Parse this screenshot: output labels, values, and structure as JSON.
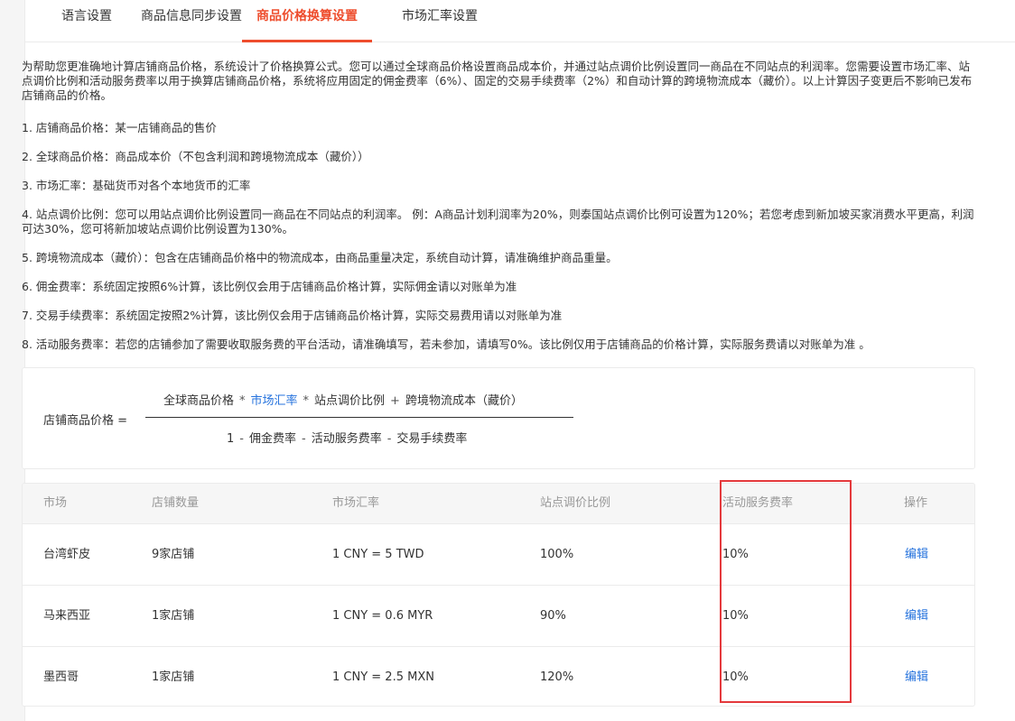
{
  "tabs": [
    {
      "label": "语言设置",
      "active": false
    },
    {
      "label": "商品信息同步设置",
      "active": false
    },
    {
      "label": "商品价格换算设置",
      "active": true
    },
    {
      "label": "市场汇率设置",
      "active": false
    }
  ],
  "intro": "为帮助您更准确地计算店铺商品价格，系统设计了价格换算公式。您可以通过全球商品价格设置商品成本价，并通过站点调价比例设置同一商品在不同站点的利润率。您需要设置市场汇率、站点调价比例和活动服务费率以用于换算店铺商品价格，系统将应用固定的佣金费率（6%）、固定的交易手续费率（2%）和自动计算的跨境物流成本（藏价）。以上计算因子变更后不影响已发布店铺商品的价格。",
  "rules": [
    "1. 店铺商品价格：某一店铺商品的售价",
    "2. 全球商品价格：商品成本价（不包含利润和跨境物流成本（藏价））",
    "3. 市场汇率：基础货币对各个本地货币的汇率",
    "4. 站点调价比例：您可以用站点调价比例设置同一商品在不同站点的利润率。 例：A商品计划利润率为20%，则泰国站点调价比例可设置为120%；若您考虑到新加坡买家消费水平更高，利润可达30%，您可将新加坡站点调价比例设置为130%。",
    "5. 跨境物流成本（藏价）：包含在店铺商品价格中的物流成本，由商品重量决定，系统自动计算，请准确维护商品重量。",
    "6. 佣金费率：系统固定按照6%计算，该比例仅会用于店铺商品价格计算，实际佣金请以对账单为准",
    "7. 交易手续费率：系统固定按照2%计算，该比例仅会用于店铺商品价格计算，实际交易费用请以对账单为准",
    "8. 活动服务费率：若您的店铺参加了需要收取服务费的平台活动，请准确填写，若未参加，请填写0%。该比例仅用于店铺商品的价格计算，实际服务费请以对账单为准 。"
  ],
  "formula": {
    "left": "店铺商品价格 =",
    "num": [
      "全球商品价格",
      "*",
      "市场汇率",
      "*",
      "站点调价比例",
      "+",
      "跨境物流成本（藏价）"
    ],
    "den": [
      "1",
      "-",
      "佣金费率",
      "-",
      "活动服务费率",
      "-",
      "交易手续费率"
    ]
  },
  "table": {
    "headers": [
      "市场",
      "店铺数量",
      "市场汇率",
      "站点调价比例",
      "活动服务费率",
      "操作"
    ],
    "rows": [
      {
        "market": "台湾虾皮",
        "shops": "9家店铺",
        "rate": "1 CNY = 5 TWD",
        "adjust": "100%",
        "fee": "10%",
        "action": "编辑"
      },
      {
        "market": "马来西亚",
        "shops": "1家店铺",
        "rate": "1 CNY = 0.6 MYR",
        "adjust": "90%",
        "fee": "10%",
        "action": "编辑"
      },
      {
        "market": "墨西哥",
        "shops": "1家店铺",
        "rate": "1 CNY = 2.5 MXN",
        "adjust": "120%",
        "fee": "10%",
        "action": "编辑"
      }
    ]
  },
  "colors": {
    "accent": "#ee4d2d",
    "link": "#2673dd",
    "highlight": "#e4393c"
  }
}
